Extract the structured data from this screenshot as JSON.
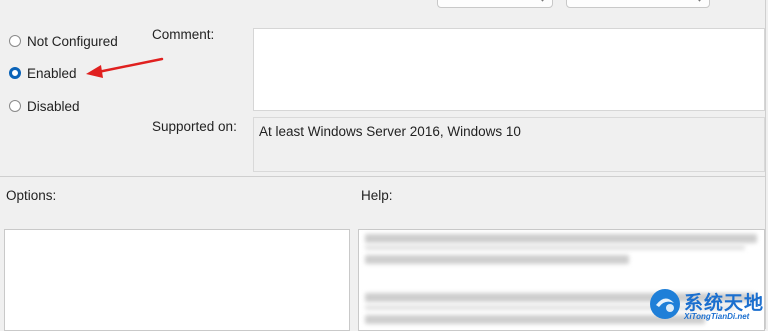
{
  "policy": {
    "state_options": [
      {
        "label": "Not Configured",
        "checked": false
      },
      {
        "label": "Enabled",
        "checked": true
      },
      {
        "label": "Disabled",
        "checked": false
      }
    ],
    "comment_label": "Comment:",
    "comment_value": "",
    "supported_on_label": "Supported on:",
    "supported_on_value": "At least Windows Server 2016, Windows 10",
    "options_label": "Options:",
    "help_label": "Help:"
  },
  "watermark": {
    "title": "系统天地",
    "subtitle": "XiTongTianDi.net"
  },
  "colors": {
    "accent": "#0a63b8",
    "annotation_arrow": "#e0201f",
    "watermark": "#1b6fcf"
  }
}
